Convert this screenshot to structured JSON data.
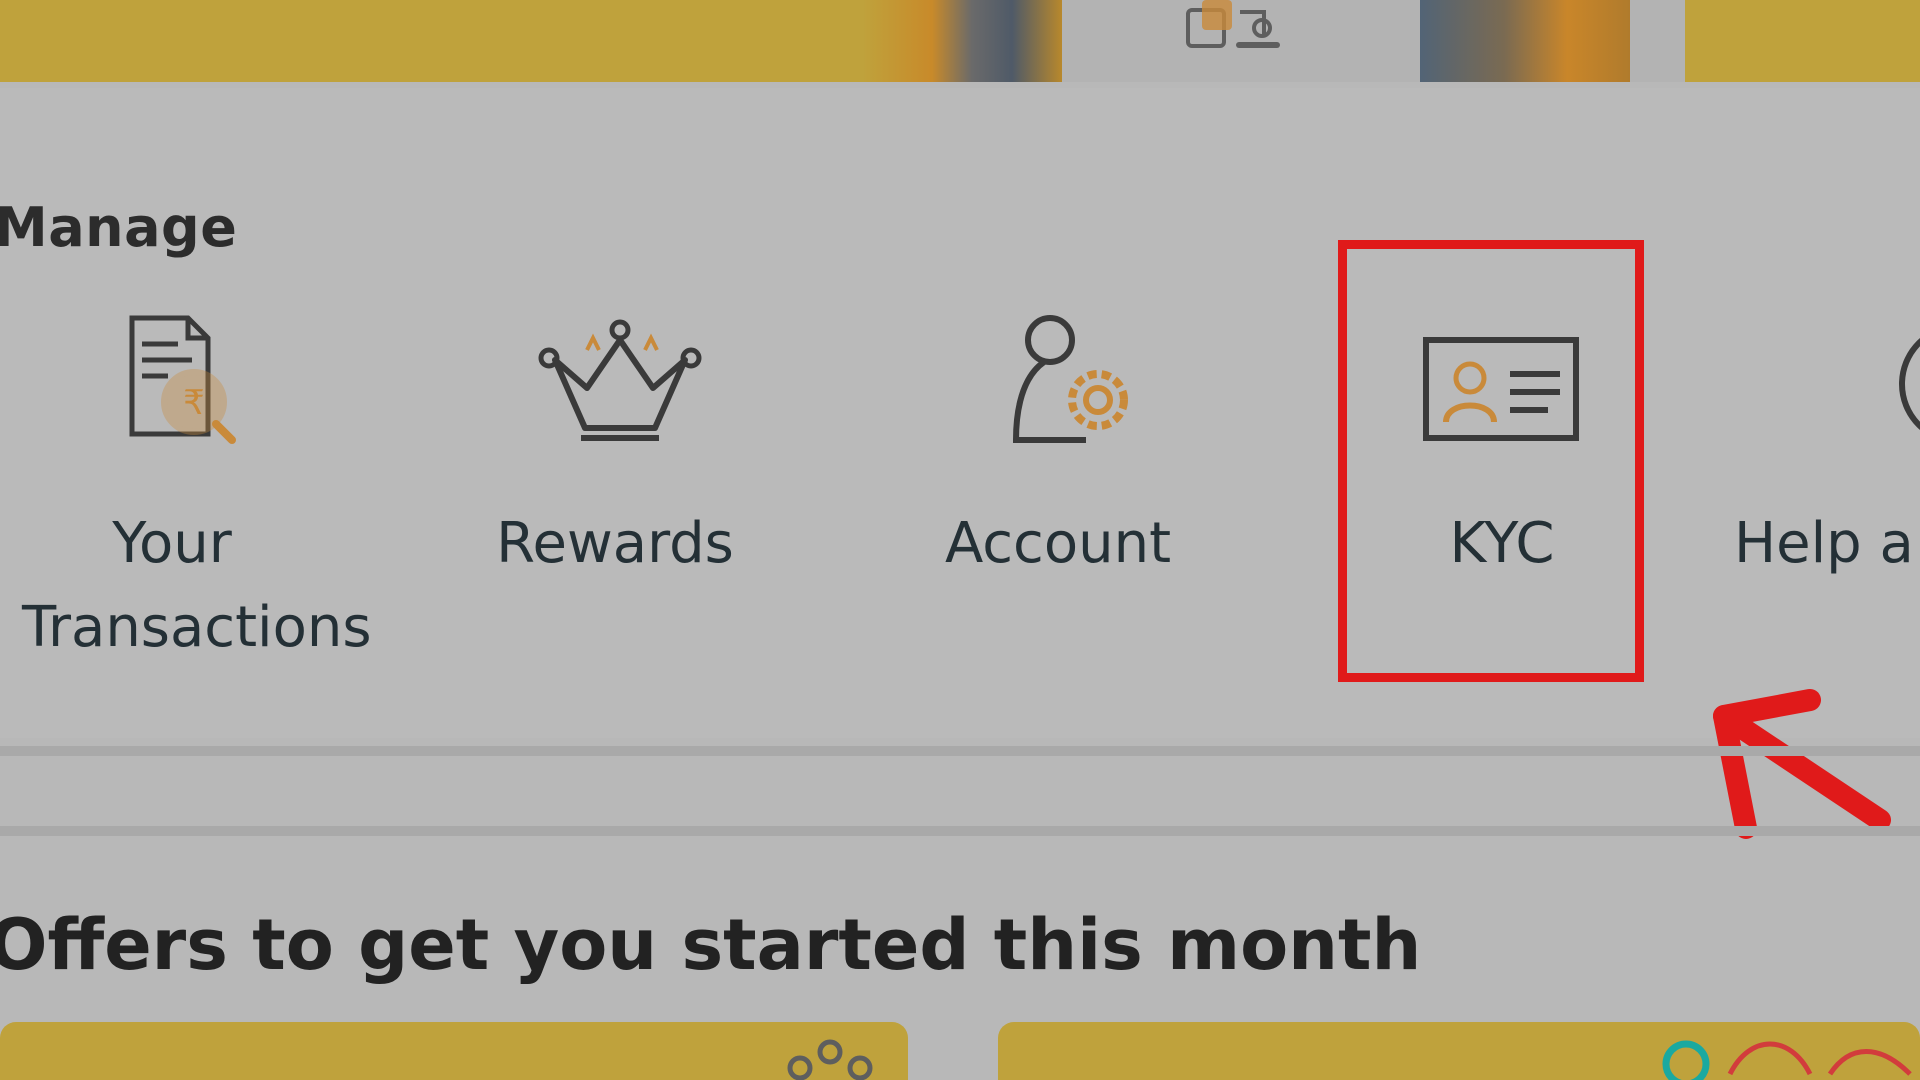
{
  "manage": {
    "title": "Manage",
    "items": [
      {
        "line1": "Your",
        "line2": "Transactions",
        "icon": "transactions-rupee-document-icon"
      },
      {
        "label": "Rewards",
        "icon": "crown-icon"
      },
      {
        "label": "Account",
        "icon": "user-settings-icon"
      },
      {
        "label": "KYC",
        "icon": "id-card-icon"
      },
      {
        "label": "Help a",
        "icon": "help-icon"
      }
    ]
  },
  "offers": {
    "title": "Offers to get you started this month"
  },
  "annotation": {
    "highlight_color": "#e01a1a",
    "highlighted_item": "KYC"
  },
  "colors": {
    "accent_orange": "#c98a3a",
    "banner_gold": "#bfa23c",
    "text_dark": "#243036"
  }
}
